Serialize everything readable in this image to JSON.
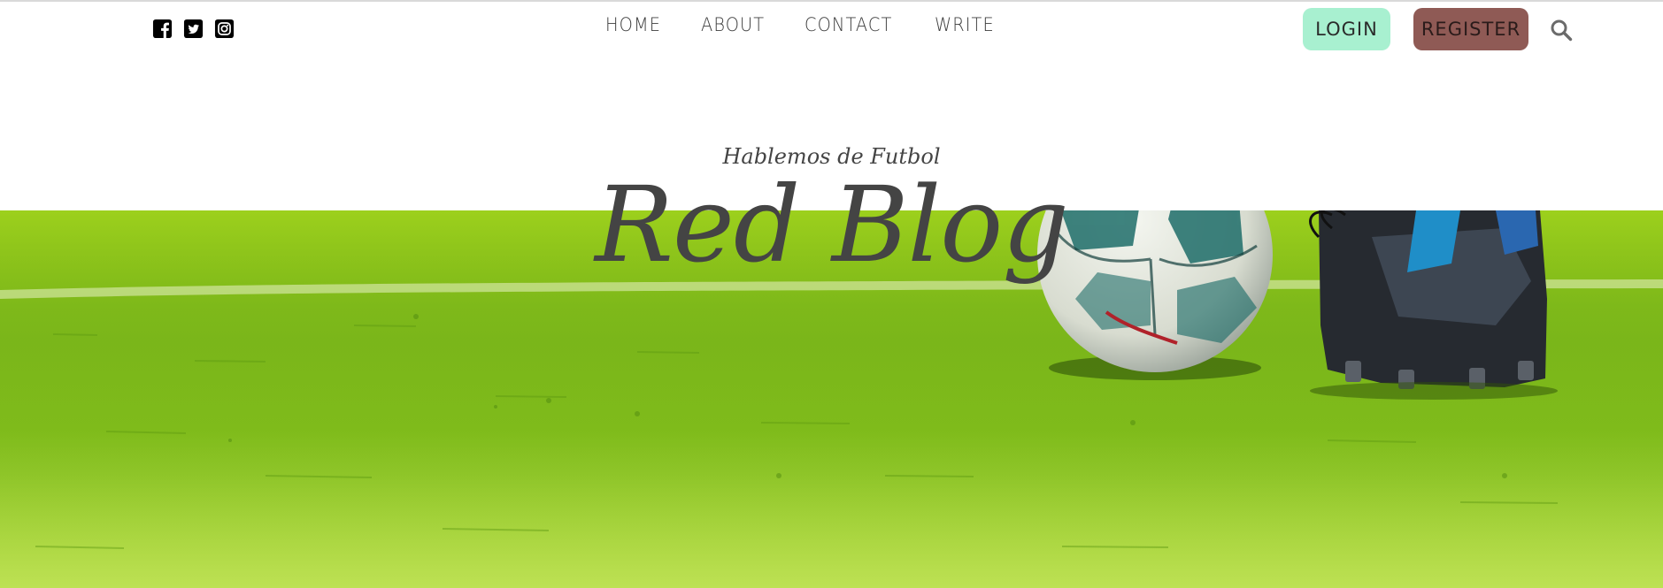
{
  "header": {
    "social": [
      {
        "icon": "facebook-icon"
      },
      {
        "icon": "twitter-icon"
      },
      {
        "icon": "instagram-icon"
      }
    ],
    "nav": [
      "HOME",
      "ABOUT",
      "CONTACT",
      "WRITE"
    ],
    "login_label": "LOGIN",
    "register_label": "REGISTER",
    "search_icon": "search-icon"
  },
  "hero": {
    "subtitle": "Hablemos de Futbol",
    "title": "Red Blog",
    "image": "soccer-ball-on-grass-image"
  },
  "colors": {
    "login_bg": "#a8f0d0",
    "register_bg": "#8f5a55",
    "text": "#444444",
    "grass": "#7ab91a"
  }
}
